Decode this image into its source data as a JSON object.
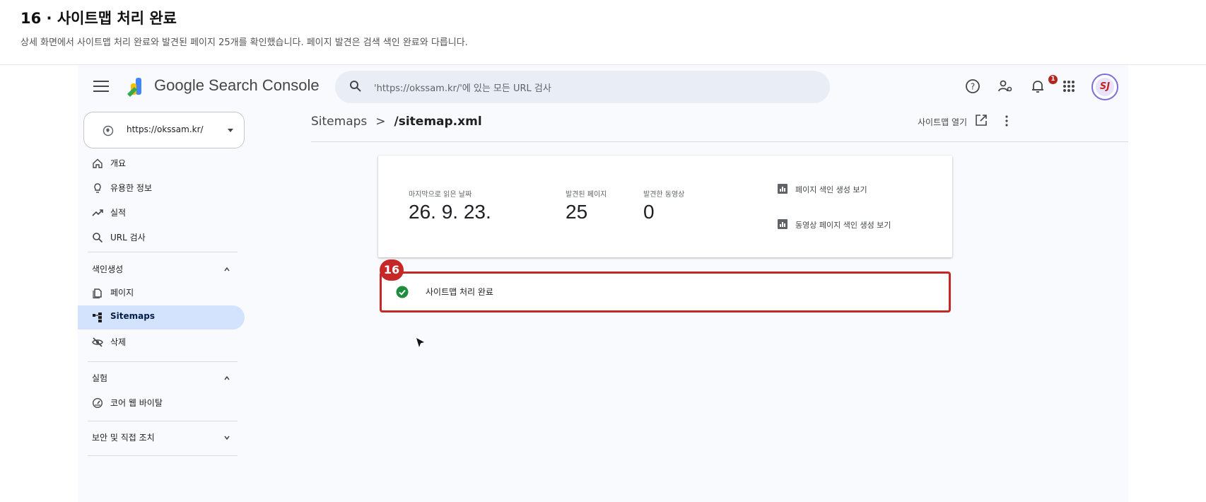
{
  "caption": {
    "title": "16 · 사이트맵 처리 완료",
    "subtitle": "상세 화면에서 사이트맵 처리 완료와 발견된 페이지 25개를 확인했습니다. 페이지 발견은 검색 색인 완료와 다릅니다."
  },
  "topbar": {
    "brand": "Google Search Console",
    "search_placeholder": "'https://okssam.kr/'에 있는 모든 URL 검사",
    "notification_count": "1",
    "avatar_text": "SJ",
    "icons": [
      "help-icon",
      "manage-users-icon",
      "notifications-icon",
      "apps-grid-icon"
    ]
  },
  "property": {
    "url": "https://okssam.kr/"
  },
  "nav": {
    "items_top": [
      {
        "label": "개요",
        "icon": "home-icon"
      },
      {
        "label": "유용한 정보",
        "icon": "lightbulb-icon"
      },
      {
        "label": "실적",
        "icon": "trending-icon"
      },
      {
        "label": "URL 검사",
        "icon": "search-icon"
      }
    ],
    "section_indexing": "색인생성",
    "items_indexing": [
      {
        "label": "페이지",
        "icon": "pages-icon"
      },
      {
        "label": "Sitemaps",
        "icon": "sitemap-icon",
        "active": true
      },
      {
        "label": "삭제",
        "icon": "removals-icon"
      }
    ],
    "section_experience": "실험",
    "items_experience": [
      {
        "label": "코어 웹 바이탈",
        "icon": "gauge-icon"
      }
    ],
    "section_security": "보안 및 직접 조치"
  },
  "breadcrumb": {
    "parent": "Sitemaps",
    "separator": ">",
    "current": "/sitemap.xml"
  },
  "actions": {
    "open_sitemap": "사이트맵 열기"
  },
  "stats": {
    "last_read_label": "마지막으로 읽은 날짜",
    "last_read_value": "26. 9. 23.",
    "pages_label": "발견된 페이지",
    "pages_value": "25",
    "videos_label": "발견한 동영상",
    "videos_value": "0",
    "link_pages": "페이지 색인 생성 보기",
    "link_videos": "동영상 페이지 색인 생성 보기"
  },
  "status": {
    "text": "사이트맵 처리 완료",
    "color": "#1e8e3e"
  },
  "annotation": {
    "step": "16",
    "color": "#c62828"
  }
}
